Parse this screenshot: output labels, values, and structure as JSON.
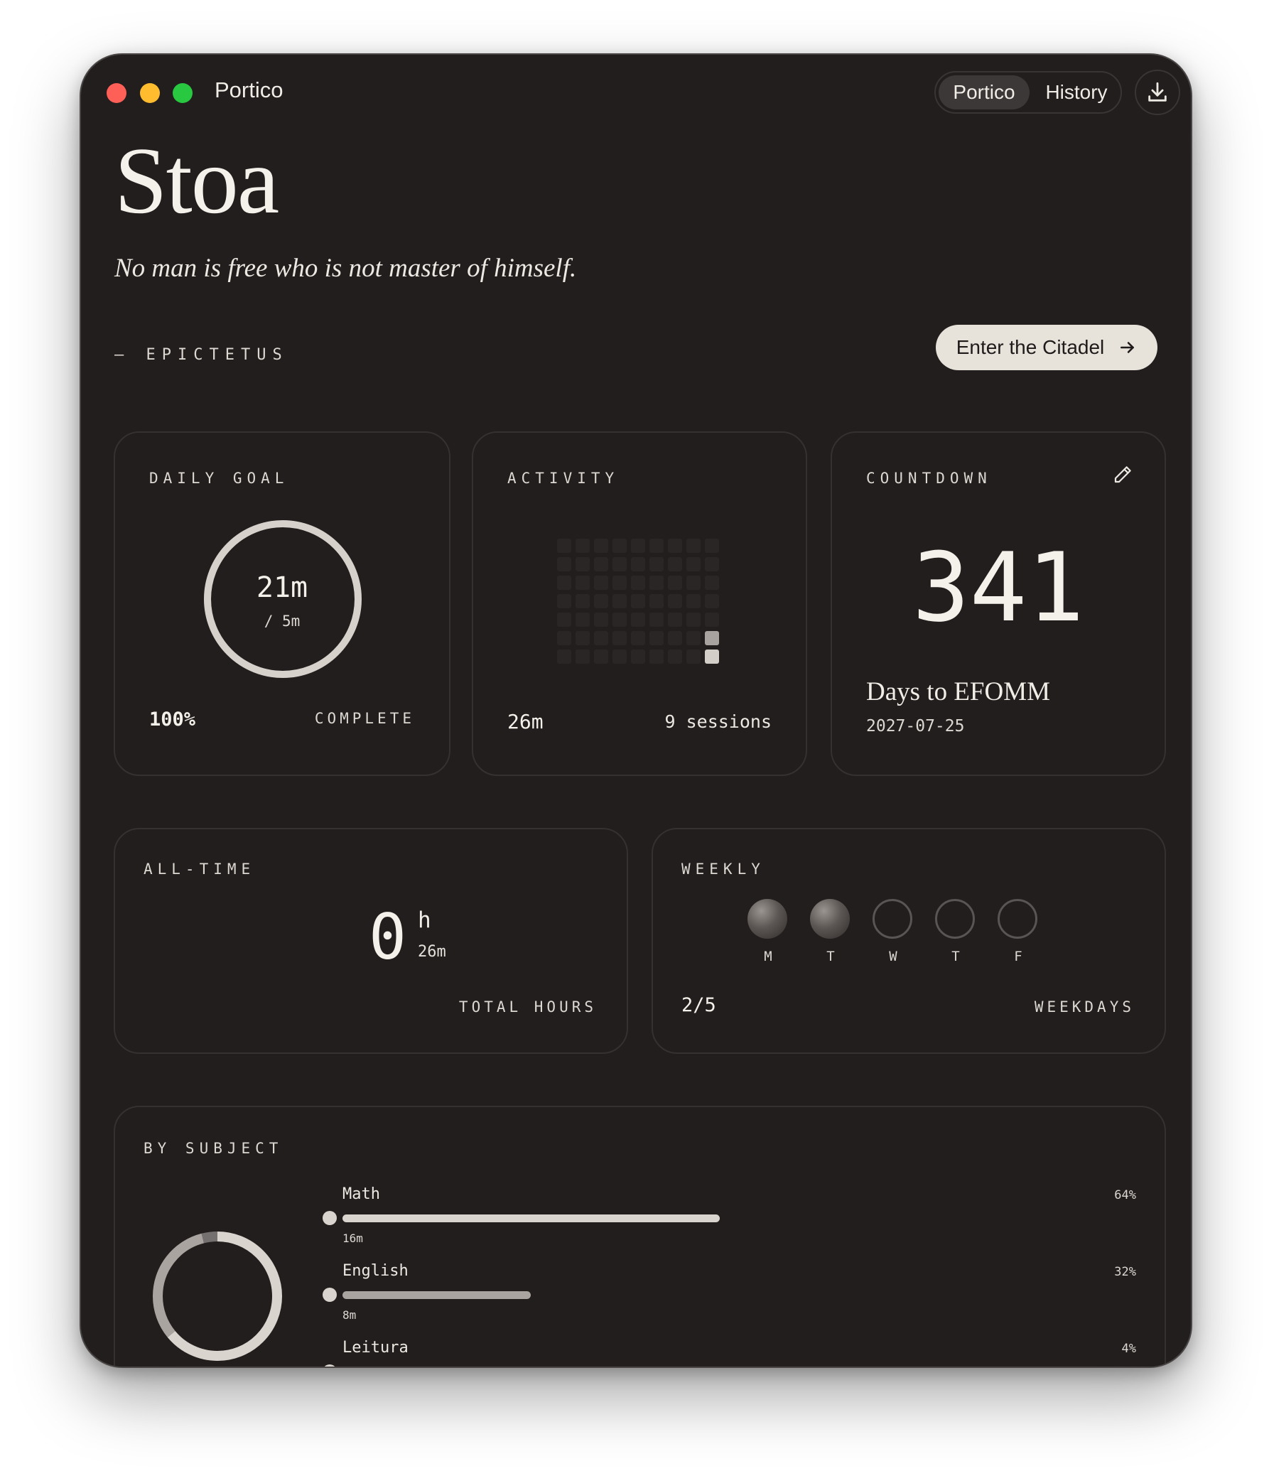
{
  "window": {
    "title": "Portico"
  },
  "nav": {
    "tabs": [
      {
        "label": "Portico",
        "active": true
      },
      {
        "label": "History",
        "active": false
      }
    ]
  },
  "hero": {
    "brand": "Stoa",
    "quote": "No man is free who is not master of himself.",
    "author": "— EPICTETUS",
    "cta_label": "Enter the Citadel"
  },
  "daily_goal": {
    "label": "DAILY GOAL",
    "value": "21m",
    "target": "/ 5m",
    "percent_text": "100%",
    "status": "COMPLETE",
    "progress": 1.0
  },
  "activity": {
    "label": "ACTIVITY",
    "total": "26m",
    "sessions": "9 sessions",
    "grid_cols": 9,
    "grid_rows": 7,
    "levels": [
      0,
      0,
      0,
      0,
      0,
      0,
      0,
      0,
      0,
      0,
      0,
      0,
      0,
      0,
      0,
      0,
      0,
      0,
      0,
      0,
      0,
      0,
      0,
      0,
      0,
      0,
      0,
      0,
      0,
      0,
      0,
      0,
      0,
      0,
      0,
      0,
      0,
      0,
      0,
      0,
      0,
      0,
      0,
      0,
      0,
      0,
      0,
      0,
      0,
      0,
      0,
      0,
      0,
      2,
      0,
      0,
      0,
      0,
      0,
      0,
      0,
      0,
      3
    ]
  },
  "countdown": {
    "label": "COUNTDOWN",
    "days": "341",
    "description": "Days to EFOMM",
    "date": "2027-07-25"
  },
  "all_time": {
    "label": "ALL-TIME",
    "hours": "0",
    "hours_unit": "h",
    "minutes": "26m",
    "caption": "TOTAL HOURS"
  },
  "weekly": {
    "label": "WEEKLY",
    "days": [
      {
        "letter": "M",
        "done": true
      },
      {
        "letter": "T",
        "done": true
      },
      {
        "letter": "W",
        "done": false
      },
      {
        "letter": "T",
        "done": false
      },
      {
        "letter": "F",
        "done": false
      }
    ],
    "summary": "2/5",
    "caption": "WEEKDAYS"
  },
  "by_subject": {
    "label": "BY SUBJECT",
    "subjects": [
      {
        "name": "Math",
        "percent_text": "64%",
        "share": 0.64,
        "minutes": "16m",
        "color": "#d9d4cd"
      },
      {
        "name": "English",
        "percent_text": "32%",
        "share": 0.32,
        "minutes": "8m",
        "color": "#a9a49f"
      },
      {
        "name": "Leitura",
        "percent_text": "4%",
        "share": 0.04,
        "minutes": "",
        "color": "#757070"
      }
    ]
  },
  "colors": {
    "background": "#221e1e",
    "card_border": "#363131",
    "accent": "#e7e2da"
  }
}
